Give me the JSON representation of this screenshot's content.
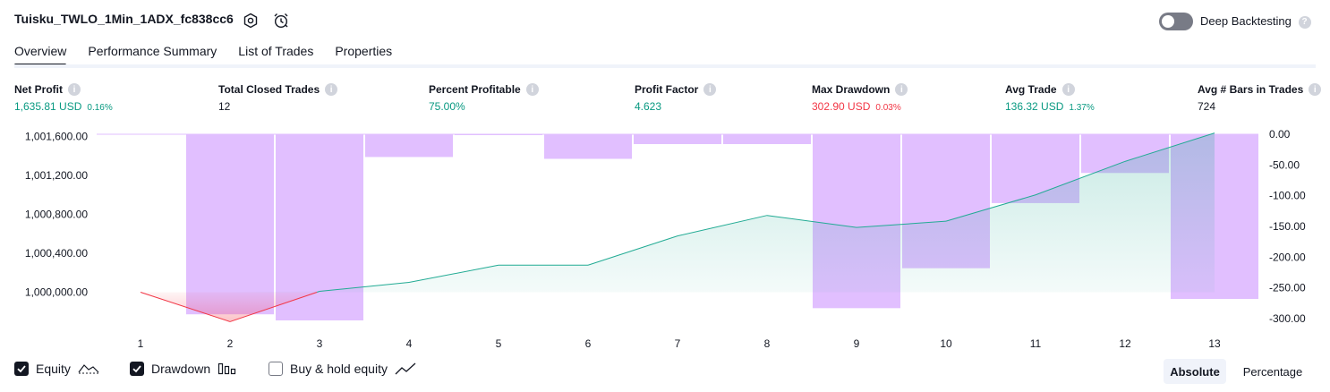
{
  "header": {
    "strategy_name": "Tuisku_TWLO_1Min_1ADX_fc838cc6",
    "deep_backtesting_label": "Deep Backtesting",
    "deep_backtesting_enabled": false,
    "help_glyph": "?"
  },
  "tabs": [
    {
      "label": "Overview",
      "active": true
    },
    {
      "label": "Performance Summary",
      "active": false
    },
    {
      "label": "List of Trades",
      "active": false
    },
    {
      "label": "Properties",
      "active": false
    }
  ],
  "metrics": [
    {
      "label": "Net Profit",
      "value": "1,635.81 USD",
      "sub": "0.16%",
      "tone": "pos"
    },
    {
      "label": "Total Closed Trades",
      "value": "12",
      "sub": "",
      "tone": "neu"
    },
    {
      "label": "Percent Profitable",
      "value": "75.00%",
      "sub": "",
      "tone": "pos"
    },
    {
      "label": "Profit Factor",
      "value": "4.623",
      "sub": "",
      "tone": "pos"
    },
    {
      "label": "Max Drawdown",
      "value": "302.90 USD",
      "sub": "0.03%",
      "tone": "neg"
    },
    {
      "label": "Avg Trade",
      "value": "136.32 USD",
      "sub": "1.37%",
      "tone": "pos"
    },
    {
      "label": "Avg # Bars in Trades",
      "value": "724",
      "sub": "",
      "tone": "neu"
    }
  ],
  "legend": {
    "equity_label": "Equity",
    "drawdown_label": "Drawdown",
    "buy_hold_label": "Buy & hold equity",
    "equity_checked": true,
    "drawdown_checked": true,
    "buy_hold_checked": false
  },
  "view_modes": {
    "absolute_label": "Absolute",
    "percentage_label": "Percentage",
    "selected": "Absolute"
  },
  "colors": {
    "positive": "#089981",
    "negative": "#f23645",
    "drawdown_bar": "#e1bfff",
    "equity_line": "#22ab94",
    "text": "#131722"
  },
  "chart_data": {
    "type": "line",
    "x": [
      1,
      2,
      3,
      4,
      5,
      6,
      7,
      8,
      9,
      10,
      11,
      12,
      13
    ],
    "x_tick_labels": [
      "1",
      "2",
      "3",
      "4",
      "5",
      "6",
      "7",
      "8",
      "9",
      "10",
      "11",
      "12",
      "13"
    ],
    "series": [
      {
        "name": "Equity",
        "axis": "left",
        "values": [
          1000000.0,
          999697.1,
          1000009.0,
          1000101.0,
          1000278.0,
          1000278.0,
          1000578.0,
          1000789.0,
          1000665.0,
          1000730.0,
          1001000.0,
          1001344.0,
          1001635.81
        ]
      },
      {
        "name": "Drawdown",
        "type": "bar",
        "axis": "right",
        "values": [
          null,
          -293,
          -302.9,
          -37,
          0,
          -40,
          -16,
          -16,
          -283,
          -218,
          -112,
          -63,
          -268
        ]
      }
    ],
    "left_axis": {
      "ticks": [
        1000000,
        1000400,
        1000800,
        1001200,
        1001600
      ],
      "tick_labels": [
        "1,000,000.00",
        "1,000,400.00",
        "1,000,800.00",
        "1,001,200.00",
        "1,001,600.00"
      ]
    },
    "right_axis": {
      "ticks": [
        0,
        -50,
        -100,
        -150,
        -200,
        -250,
        -300
      ],
      "tick_labels": [
        "0.00",
        "-50.00",
        "-100.00",
        "-150.00",
        "-200.00",
        "-250.00",
        "-300.00"
      ]
    },
    "grid": false
  }
}
